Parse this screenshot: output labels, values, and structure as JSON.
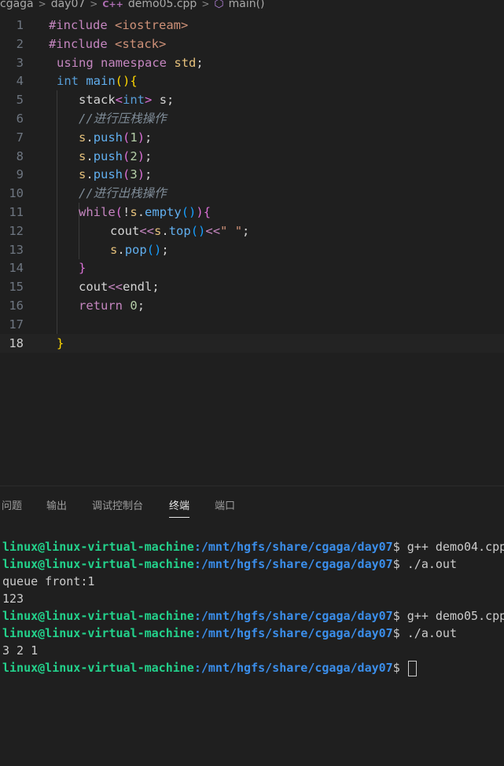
{
  "breadcrumb": {
    "items": [
      "cgaga",
      "day07",
      "demo05.cpp",
      "main()"
    ],
    "separator": ">",
    "file_icon_text": "C++"
  },
  "editor": {
    "active_line": 18,
    "lines": [
      {
        "n": "1",
        "tokens": [
          {
            "c": "inc",
            "t": "#include "
          },
          {
            "c": "hd",
            "t": "<iostream>"
          }
        ]
      },
      {
        "n": "2",
        "tokens": [
          {
            "c": "inc",
            "t": "#include "
          },
          {
            "c": "hd",
            "t": "<stack>"
          }
        ]
      },
      {
        "n": "3",
        "tokens": [
          {
            "c": "kw",
            "t": "using"
          },
          {
            "c": "id",
            "t": " "
          },
          {
            "c": "kw",
            "t": "namespace"
          },
          {
            "c": "id",
            "t": " "
          },
          {
            "c": "ns",
            "t": "std"
          },
          {
            "c": "op",
            "t": ";"
          }
        ]
      },
      {
        "n": "4",
        "tokens": [
          {
            "c": "ty",
            "t": "int"
          },
          {
            "c": "id",
            "t": " "
          },
          {
            "c": "fn",
            "t": "main"
          },
          {
            "c": "br2",
            "t": "()"
          },
          {
            "c": "br2",
            "t": "{"
          }
        ]
      },
      {
        "n": "5",
        "tokens": [
          {
            "c": "id",
            "t": "stack"
          },
          {
            "c": "br1",
            "t": "<"
          },
          {
            "c": "ty",
            "t": "int"
          },
          {
            "c": "br1",
            "t": ">"
          },
          {
            "c": "id",
            "t": " s;"
          }
        ]
      },
      {
        "n": "6",
        "tokens": [
          {
            "c": "com2",
            "t": "//进行压栈操作"
          }
        ]
      },
      {
        "n": "7",
        "tokens": [
          {
            "c": "var",
            "t": "s"
          },
          {
            "c": "op",
            "t": "."
          },
          {
            "c": "fn",
            "t": "push"
          },
          {
            "c": "br1",
            "t": "("
          },
          {
            "c": "num",
            "t": "1"
          },
          {
            "c": "br1",
            "t": ")"
          },
          {
            "c": "op",
            "t": ";"
          }
        ]
      },
      {
        "n": "8",
        "tokens": [
          {
            "c": "var",
            "t": "s"
          },
          {
            "c": "op",
            "t": "."
          },
          {
            "c": "fn",
            "t": "push"
          },
          {
            "c": "br1",
            "t": "("
          },
          {
            "c": "num",
            "t": "2"
          },
          {
            "c": "br1",
            "t": ")"
          },
          {
            "c": "op",
            "t": ";"
          }
        ]
      },
      {
        "n": "9",
        "tokens": [
          {
            "c": "var",
            "t": "s"
          },
          {
            "c": "op",
            "t": "."
          },
          {
            "c": "fn",
            "t": "push"
          },
          {
            "c": "br1",
            "t": "("
          },
          {
            "c": "num",
            "t": "3"
          },
          {
            "c": "br1",
            "t": ")"
          },
          {
            "c": "op",
            "t": ";"
          }
        ]
      },
      {
        "n": "10",
        "tokens": [
          {
            "c": "com2",
            "t": "//进行出栈操作"
          }
        ]
      },
      {
        "n": "11",
        "tokens": [
          {
            "c": "kw",
            "t": "while"
          },
          {
            "c": "br1",
            "t": "("
          },
          {
            "c": "op",
            "t": "!"
          },
          {
            "c": "var",
            "t": "s"
          },
          {
            "c": "op",
            "t": "."
          },
          {
            "c": "fn",
            "t": "empty"
          },
          {
            "c": "br3",
            "t": "()"
          },
          {
            "c": "br1",
            "t": ")"
          },
          {
            "c": "br1",
            "t": "{"
          }
        ]
      },
      {
        "n": "12",
        "tokens": [
          {
            "c": "id",
            "t": "cout"
          },
          {
            "c": "kw",
            "t": "<<"
          },
          {
            "c": "var",
            "t": "s"
          },
          {
            "c": "op",
            "t": "."
          },
          {
            "c": "fn",
            "t": "top"
          },
          {
            "c": "br3",
            "t": "()"
          },
          {
            "c": "kw",
            "t": "<<"
          },
          {
            "c": "str",
            "t": "\" \""
          },
          {
            "c": "op",
            "t": ";"
          }
        ]
      },
      {
        "n": "13",
        "tokens": [
          {
            "c": "var",
            "t": "s"
          },
          {
            "c": "op",
            "t": "."
          },
          {
            "c": "fn",
            "t": "pop"
          },
          {
            "c": "br3",
            "t": "()"
          },
          {
            "c": "op",
            "t": ";"
          }
        ]
      },
      {
        "n": "14",
        "tokens": [
          {
            "c": "br1",
            "t": "}"
          }
        ]
      },
      {
        "n": "15",
        "tokens": [
          {
            "c": "id",
            "t": "cout"
          },
          {
            "c": "kw",
            "t": "<<"
          },
          {
            "c": "id",
            "t": "endl;"
          }
        ]
      },
      {
        "n": "16",
        "tokens": [
          {
            "c": "kw",
            "t": "return"
          },
          {
            "c": "id",
            "t": " "
          },
          {
            "c": "num",
            "t": "0"
          },
          {
            "c": "op",
            "t": ";"
          }
        ]
      },
      {
        "n": "17",
        "tokens": []
      },
      {
        "n": "18",
        "tokens": [
          {
            "c": "br2",
            "t": "}"
          }
        ]
      }
    ]
  },
  "panel": {
    "tabs": [
      {
        "label": "问题",
        "active": false
      },
      {
        "label": "输出",
        "active": false
      },
      {
        "label": "调试控制台",
        "active": false
      },
      {
        "label": "终端",
        "active": true
      },
      {
        "label": "端口",
        "active": false
      }
    ]
  },
  "terminal": {
    "user": "linux@linux-virtual-machine",
    "path": ":/mnt/hgfs/share/cgaga/day07",
    "prompt_suffix": "$ ",
    "lines": [
      {
        "type": "cmd",
        "cmd": "g++ demo04.cpp"
      },
      {
        "type": "cmd",
        "cmd": "./a.out"
      },
      {
        "type": "out",
        "text": "queue front:1"
      },
      {
        "type": "out",
        "text": "123"
      },
      {
        "type": "cmd",
        "cmd": "g++ demo05.cpp"
      },
      {
        "type": "cmd",
        "cmd": "./a.out"
      },
      {
        "type": "out",
        "text": "3 2 1"
      },
      {
        "type": "cmd",
        "cmd": "",
        "cursor": true
      }
    ]
  }
}
